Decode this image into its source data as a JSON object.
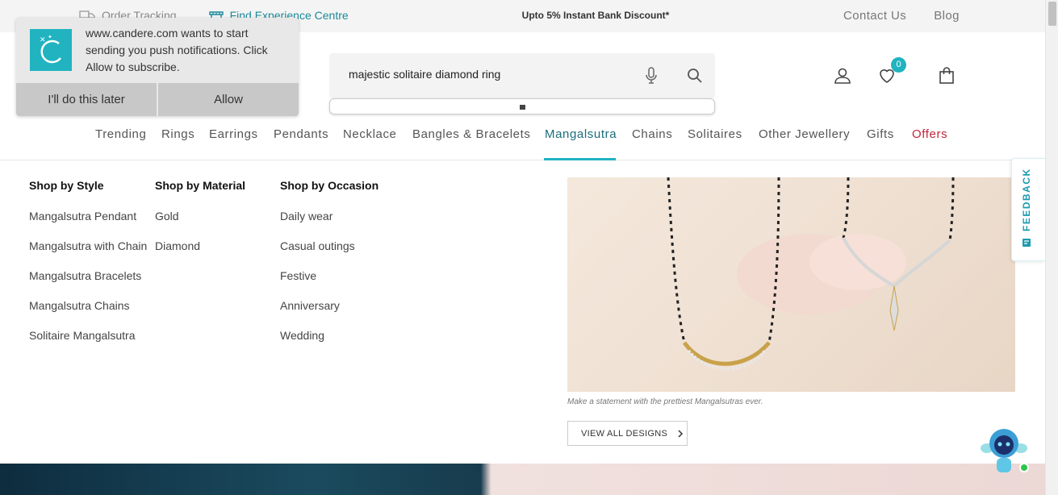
{
  "topbar": {
    "order_tracking": "Order Tracking",
    "experience_centre": "Find Experience Centre",
    "promo": "Upto 5% Instant Bank Discount*",
    "contact": "Contact Us",
    "blog": "Blog"
  },
  "notification": {
    "message": "www.candere.com wants to start sending you push notifications. Click Allow to subscribe.",
    "later_label": "I'll do this later",
    "allow_label": "Allow"
  },
  "search": {
    "value": "majestic solitaire diamond ring"
  },
  "header": {
    "wishlist_count": "0"
  },
  "nav": {
    "items": [
      "Trending",
      "Rings",
      "Earrings",
      "Pendants",
      "Necklace",
      "Bangles & Bracelets",
      "Mangalsutra",
      "Chains",
      "Solitaires",
      "Other Jewellery",
      "Gifts",
      "Offers"
    ],
    "active": "Mangalsutra"
  },
  "menu": {
    "style": {
      "heading": "Shop by Style",
      "links": [
        "Mangalsutra Pendant",
        "Mangalsutra with Chain",
        "Mangalsutra Bracelets",
        "Mangalsutra Chains",
        "Solitaire Mangalsutra"
      ]
    },
    "material": {
      "heading": "Shop by Material",
      "links": [
        "Gold",
        "Diamond"
      ]
    },
    "occasion": {
      "heading": "Shop by Occasion",
      "links": [
        "Daily wear",
        "Casual outings",
        "Festive",
        "Anniversary",
        "Wedding"
      ]
    },
    "promo_caption": "Make a statement with the prettiest Mangalsutras ever.",
    "view_all_label": "VIEW ALL DESIGNS"
  },
  "feedback": {
    "label": "FEEDBACK"
  },
  "colors": {
    "accent": "#21b3c0",
    "offers": "#c2253b",
    "active_nav": "#1a6e7b"
  }
}
